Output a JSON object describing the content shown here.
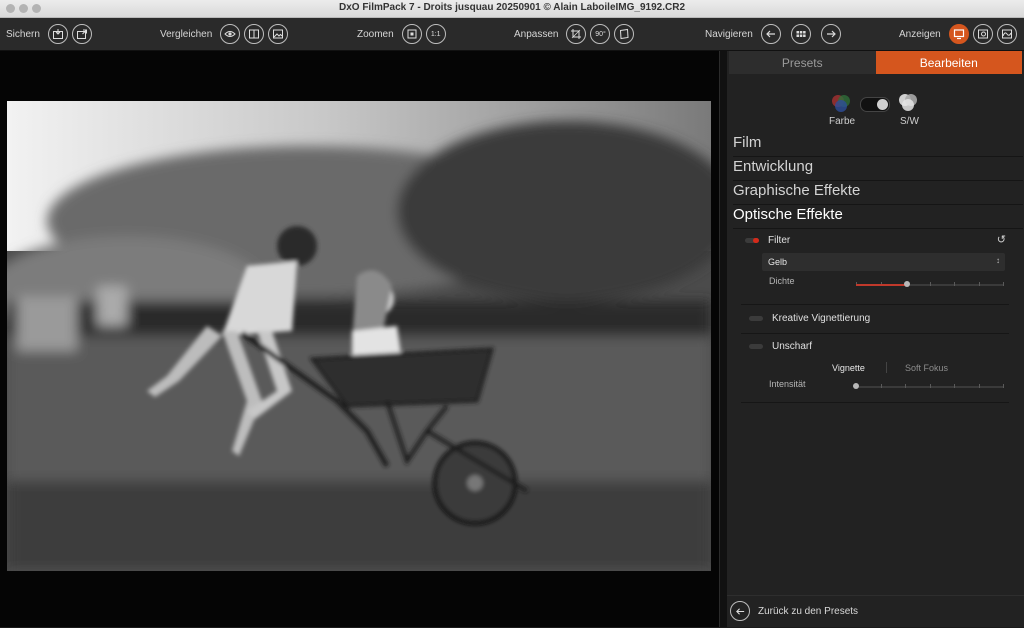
{
  "window": {
    "title": "DxO FilmPack 7 - Droits jusquau 20250901 © Alain LaboileIMG_9192.CR2"
  },
  "toolbar": {
    "save_label": "Sichern",
    "compare_label": "Vergleichen",
    "zoom_label": "Zoomen",
    "zoom_fit_icon": "fit-icon",
    "zoom_100_label": "1:1",
    "adjust_label": "Anpassen",
    "rotate_label": "90°",
    "navigate_label": "Navigieren",
    "display_label": "Anzeigen"
  },
  "panel": {
    "tabs": {
      "presets": "Presets",
      "edit": "Bearbeiten"
    },
    "mode": {
      "color_label": "Farbe",
      "bw_label": "S/W"
    },
    "sections": {
      "film": "Film",
      "development": "Entwicklung",
      "graphic_effects": "Graphische Effekte",
      "optical_effects": "Optische Effekte"
    },
    "filter": {
      "title": "Filter",
      "selected": "Gelb",
      "density_label": "Dichte",
      "density_value": 0.35
    },
    "creative_vignetting": {
      "title": "Kreative Vignettierung"
    },
    "blur": {
      "title": "Unscharf",
      "seg_vignette": "Vignette",
      "seg_soft_focus": "Soft Fokus",
      "intensity_label": "Intensität",
      "intensity_value": 0.0
    },
    "footer": {
      "back_label": "Zurück zu den Presets"
    }
  },
  "colors": {
    "accent": "#d5561e",
    "active_red": "#d52a1a",
    "panel_bg": "#222222",
    "toolbar_bg": "#2a2a2a"
  }
}
